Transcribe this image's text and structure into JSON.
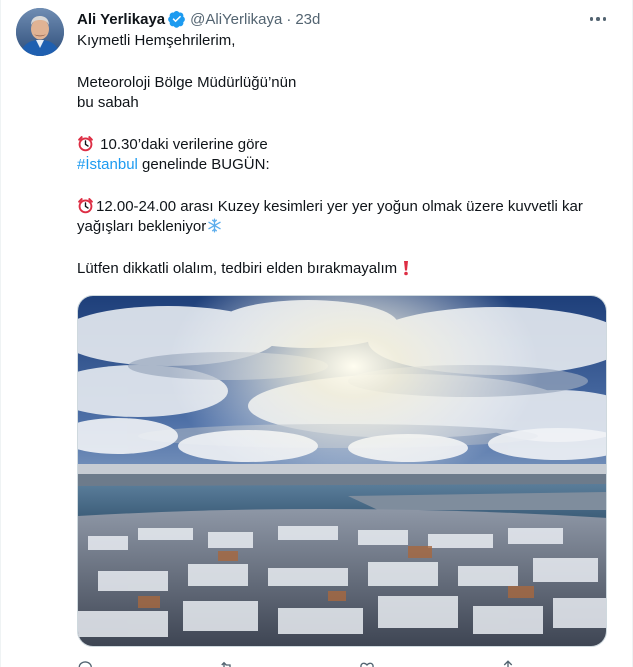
{
  "tweet": {
    "author": {
      "display_name": "Ali Yerlikaya",
      "handle": "@AliYerlikaya",
      "verified": true
    },
    "separator": "·",
    "timestamp": "23d",
    "lines": {
      "l1": "Kıymetli Hemşehrilerim,",
      "l2": "Meteoroloji Bölge Müdürlüğü’nün",
      "l3": "bu sabah",
      "l4": "10.30’daki verilerine göre",
      "l5_hashtag": "#İstanbul",
      "l5_rest": " genelinde BUGÜN:",
      "l6": "12.00-24.00 arası Kuzey kesimleri yer yer yoğun olmak üzere kuvvetli kar",
      "l7": "yağışları bekleniyor",
      "l8": "Lütfen dikkatli olalım, tedbiri elden bırakmayalım"
    },
    "emoji": {
      "clock": "alarm-clock",
      "snow": "snowflake",
      "exclamation": "red-exclamation"
    },
    "media": {
      "image": "istanbul-snowy-rooftops-golden-horn"
    },
    "actions": [
      "reply-icon",
      "retweet-icon",
      "like-icon",
      "share-icon"
    ]
  },
  "colors": {
    "link": "#1d9bf0",
    "verified": "#1d9bf0",
    "secondary_text": "#536471",
    "primary_text": "#0f1419"
  }
}
